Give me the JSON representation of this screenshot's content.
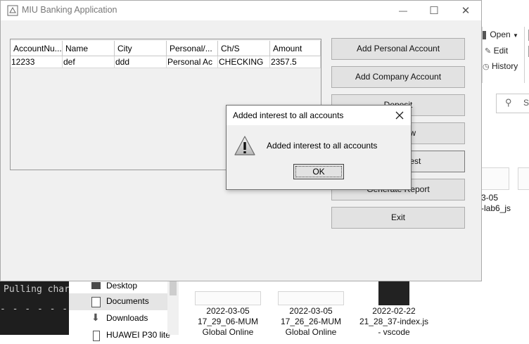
{
  "window": {
    "title": "MIU Banking Application",
    "minimize_glyph": "—",
    "maximize_glyph": "☐",
    "close_glyph": "✕"
  },
  "table": {
    "columns": [
      "AccountNu...",
      "Name",
      "City",
      "Personal/...",
      "Ch/S",
      "Amount"
    ],
    "rows": [
      [
        "12233",
        "def",
        "ddd",
        "Personal Ac",
        "CHECKING",
        "2357.5"
      ]
    ]
  },
  "buttons": {
    "add_personal": "Add Personal Account",
    "add_company": "Add Company Account",
    "deposit": "Deposit",
    "withdraw": "Withdraw",
    "add_interest": "Add Interest",
    "generate_report": "Generate Report",
    "exit": "Exit"
  },
  "dialog": {
    "title": "Added interest to all accounts",
    "message": "Added interest to all accounts",
    "ok_label": "OK",
    "icon": "warning-icon"
  },
  "background": {
    "ribbon": {
      "open": "Open",
      "edit": "Edit",
      "history": "History"
    },
    "search_glyph": "S",
    "terminal": {
      "line": "Pulling char",
      "dashes": "- - - - - - - - -"
    },
    "nav": [
      "Desktop",
      "Documents",
      "Downloads",
      "HUAWEI P30 lite"
    ],
    "files": [
      {
        "line1": "2022-03-05",
        "line2": "17_29_06-MUM",
        "line3": "Global Online"
      },
      {
        "line1": "2022-03-05",
        "line2": "17_26_26-MUM",
        "line3": "Global Online"
      },
      {
        "line1": "2022-02-22",
        "line2": "21_28_37-index.js",
        "line3": "- vscode"
      }
    ],
    "partial_file": {
      "line1": "3-05",
      "line2": "-lab6_js"
    }
  }
}
